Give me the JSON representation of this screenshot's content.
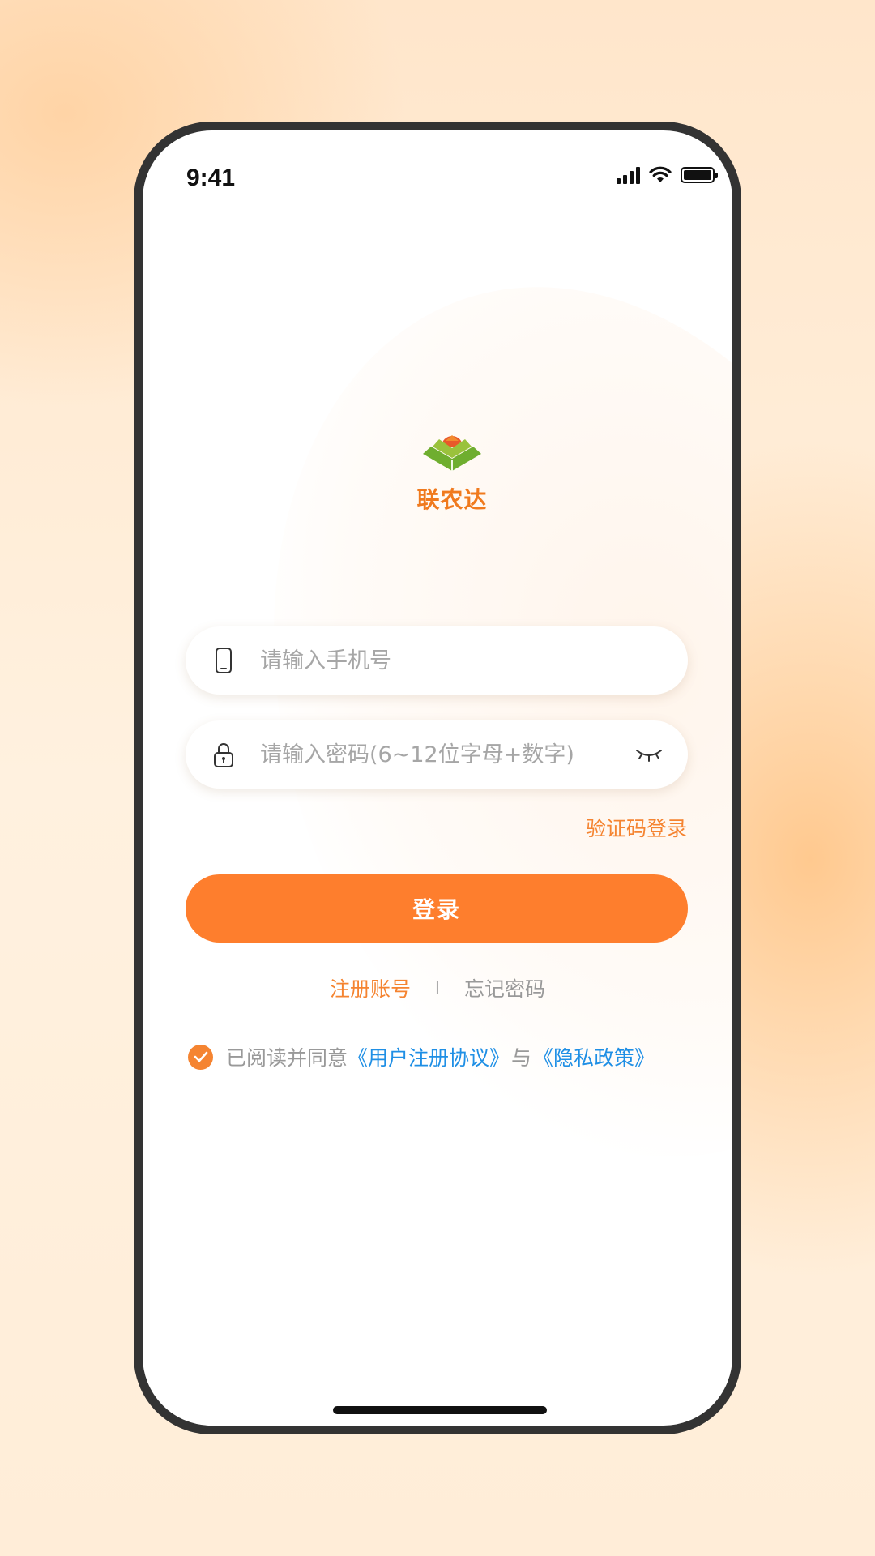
{
  "status_bar": {
    "time": "9:41",
    "icons": [
      "cellular-signal-icon",
      "wifi-icon",
      "battery-icon"
    ]
  },
  "brand": {
    "logo_icon": "book-sun-logo-icon",
    "name": "联农达",
    "color": "#f07a1e"
  },
  "form": {
    "phone": {
      "icon": "phone-icon",
      "placeholder": "请输入手机号",
      "value": ""
    },
    "password": {
      "icon": "lock-icon",
      "placeholder": "请输入密码(6~12位字母+数字)",
      "value": "",
      "toggle_icon": "eye-closed-icon"
    },
    "sms_login_label": "验证码登录",
    "login_button_label": "登录"
  },
  "links": {
    "register": "注册账号",
    "separator": "I",
    "forgot": "忘记密码"
  },
  "agreement": {
    "checked": true,
    "prefix": "已阅读并同意",
    "user_agreement": "《用户注册协议》",
    "conjunction": "与",
    "privacy_policy": "《隐私政策》"
  },
  "colors": {
    "accent": "#fe7e2d",
    "link_blue": "#1f8fe5",
    "placeholder_gray": "#a6a6a6"
  }
}
